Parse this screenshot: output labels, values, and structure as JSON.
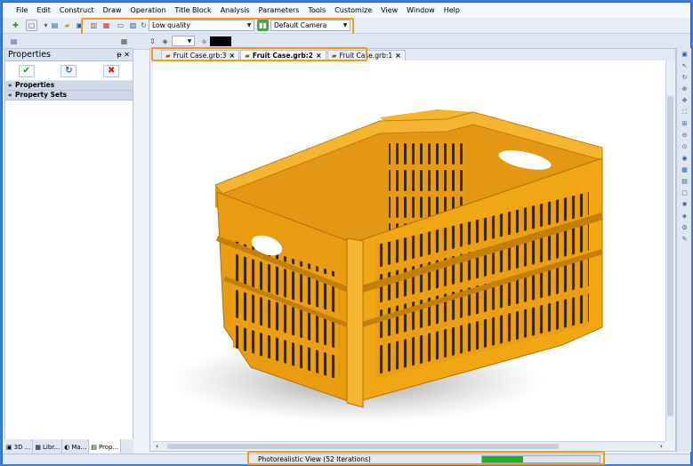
{
  "menu": [
    "File",
    "Edit",
    "Construct",
    "Draw",
    "Operation",
    "Title Block",
    "Analysis",
    "Parameters",
    "Tools",
    "Customize",
    "View",
    "Window",
    "Help"
  ],
  "toolbar": {
    "quality_value": "Low quality",
    "camera_value": "Default Camera"
  },
  "properties_panel": {
    "title": "Properties",
    "sections": [
      "Properties",
      "Property Sets"
    ],
    "tabs": [
      "3D ...",
      "Libr...",
      "Ma...",
      "Prop..."
    ]
  },
  "documents": {
    "tabs": [
      {
        "label": "Fruit Case.grb:3",
        "active": false
      },
      {
        "label": "Fruit Case.grb:2",
        "active": true
      },
      {
        "label": "Fruit Case.grb:1",
        "active": false
      }
    ]
  },
  "status": {
    "text": "Photorealistic View (52 Iterations)",
    "progress": 0.35
  },
  "colors": {
    "highlight": "#f39a1e",
    "crate": "#f0a515",
    "progress": "#1db320"
  }
}
